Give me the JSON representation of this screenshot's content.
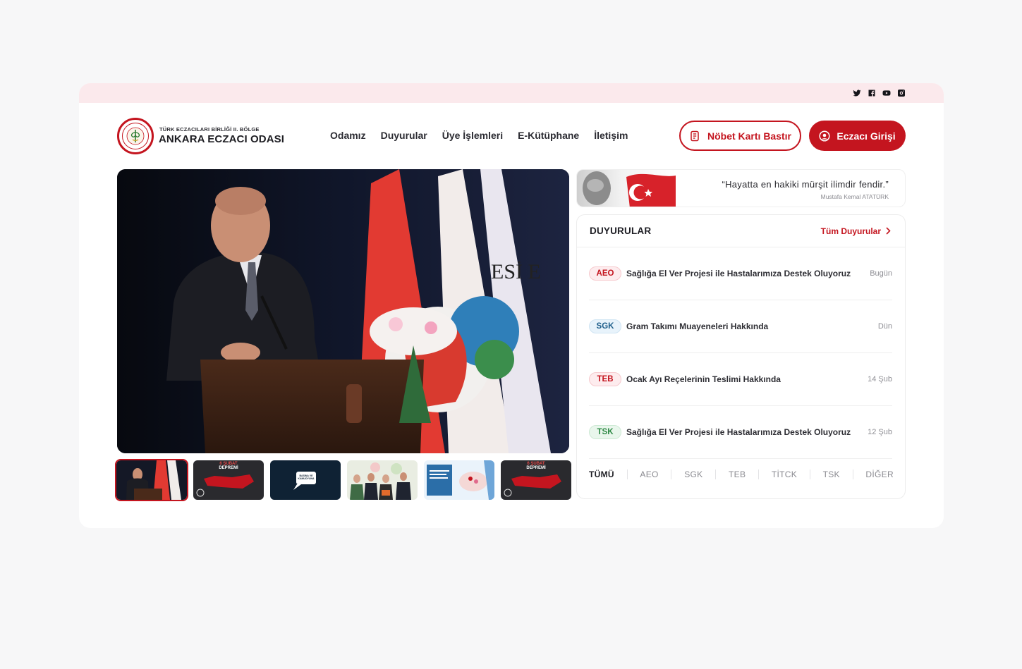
{
  "social": [
    {
      "icon": "twitter-icon"
    },
    {
      "icon": "facebook-icon"
    },
    {
      "icon": "youtube-icon"
    },
    {
      "icon": "instagram-icon"
    }
  ],
  "logo": {
    "subtitle": "TÜRK ECZACILARI BİRLİĞİ II. BÖLGE",
    "title": "ANKARA ECZACI ODASI"
  },
  "nav": [
    "Odamız",
    "Duyurular",
    "Üye İşlemleri",
    "E-Kütüphane",
    "İletişim"
  ],
  "buttons": {
    "duty_card": "Nöbet Kartı Bastır",
    "login": "Eczacı Girişi"
  },
  "quote": {
    "text": "“Hayatta en hakiki mürşit ilimdir fendir.”",
    "author": "Mustafa Kemal ATATÜRK"
  },
  "announcements": {
    "title": "DUYURULAR",
    "all_link": "Tüm Duyurular",
    "items": [
      {
        "tag": "AEO",
        "text": "Sağlığa El Ver Projesi ile Hastalarımıza Destek Oluyoruz",
        "date": "Bugün"
      },
      {
        "tag": "SGK",
        "text": "Gram Takımı Muayeneleri Hakkında",
        "date": "Dün"
      },
      {
        "tag": "TEB",
        "text": "Ocak Ayı Reçelerinin Teslimi Hakkında",
        "date": "14 Şub"
      },
      {
        "tag": "TSK",
        "text": "Sağlığa El Ver Projesi ile Hastalarımıza Destek Oluyoruz",
        "date": "12 Şub"
      }
    ],
    "filters": [
      "TÜMÜ",
      "AEO",
      "SGK",
      "TEB",
      "TİTCK",
      "TSK",
      "DİĞER"
    ]
  },
  "thumbnails": {
    "earthquake_title_1": "6 ŞUBAT",
    "earthquake_title_2": "DEPREMİ",
    "press_label_1": "BASINA VE",
    "press_label_2": "KAMUOYUNA"
  },
  "colors": {
    "brand_red": "#c4151f",
    "topbar_pink": "#fbe9ec",
    "badge_red_bg": "#fdecee",
    "badge_blue_bg": "#e8f3fb",
    "badge_blue_fg": "#1f5f8b",
    "badge_green_bg": "#e9f6ec",
    "badge_green_fg": "#2f8a46"
  }
}
